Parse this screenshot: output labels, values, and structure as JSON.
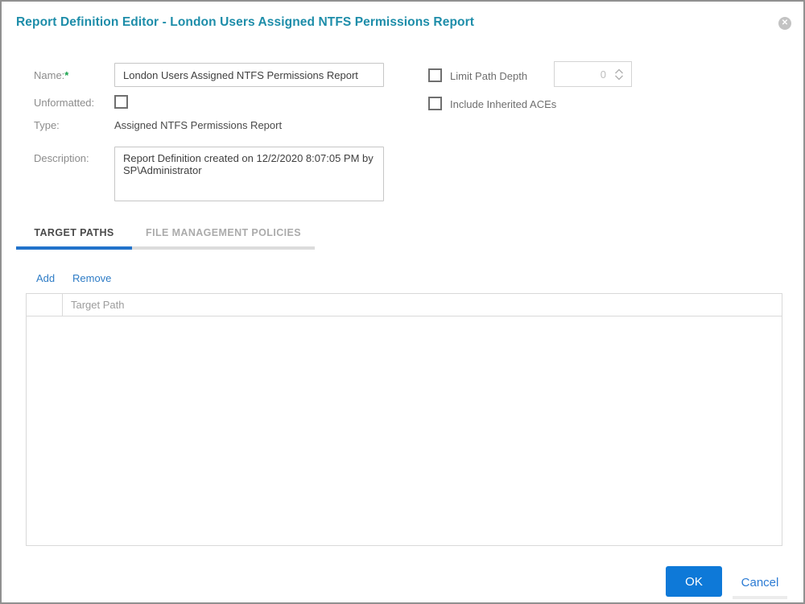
{
  "window": {
    "title": "Report Definition Editor - London Users Assigned NTFS Permissions Report"
  },
  "form": {
    "name_label": "Name:",
    "required_marker": "*",
    "name_value": "London Users Assigned NTFS Permissions Report",
    "unformatted_label": "Unformatted:",
    "unformatted_checked": false,
    "type_label": "Type:",
    "type_value": "Assigned NTFS Permissions Report",
    "description_label": "Description:",
    "description_value": "Report Definition created on 12/2/2020 8:07:05 PM by SP\\Administrator",
    "limit_path_depth_label": "Limit Path Depth",
    "limit_path_depth_checked": false,
    "limit_path_depth_value": "0",
    "include_inherited_aces_label": "Include Inherited ACEs",
    "include_inherited_aces_checked": false
  },
  "tabs": [
    {
      "label": "TARGET PATHS",
      "active": true
    },
    {
      "label": "FILE MANAGEMENT POLICIES",
      "active": false
    }
  ],
  "actions": {
    "add_label": "Add",
    "remove_label": "Remove"
  },
  "table": {
    "columns": [
      "",
      "Target Path"
    ],
    "rows": []
  },
  "footer": {
    "ok_label": "OK",
    "cancel_label": "Cancel"
  },
  "colors": {
    "title_teal": "#1d8da9",
    "primary_blue": "#0e79d8",
    "link_blue": "#2e7cc6",
    "active_tab_underline": "#2273cb",
    "required_green": "#18a24c"
  }
}
